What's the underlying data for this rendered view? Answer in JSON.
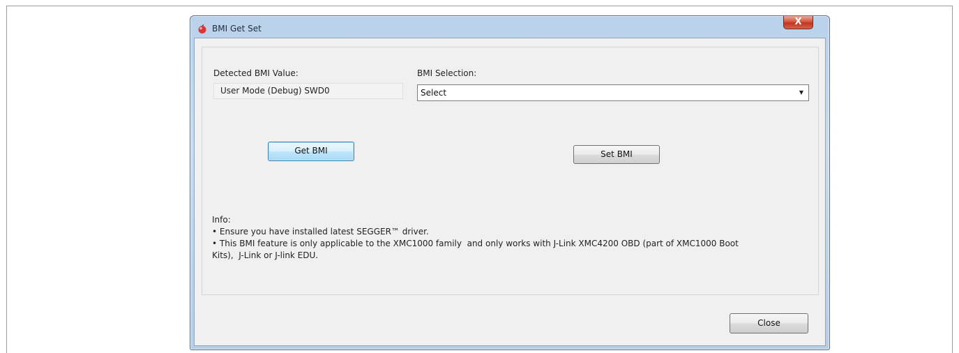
{
  "window": {
    "title": "BMI Get Set",
    "close_glyph": "X",
    "app_icon": "app-icon"
  },
  "detected": {
    "label": "Detected BMI Value:",
    "value": "User Mode (Debug) SWD0"
  },
  "selection": {
    "label": "BMI Selection:",
    "selected": "Select",
    "arrow_glyph": "▼"
  },
  "buttons": {
    "get": "Get BMI",
    "set": "Set BMI",
    "close": "Close"
  },
  "info": {
    "heading": "Info:",
    "line1": "• Ensure you have installed latest SEGGER™ driver.",
    "line2": "• This BMI feature is only applicable to the XMC1000 family  and only works with J-Link XMC4200 OBD (part of XMC1000 Boot",
    "line3": "Kits),  J-Link or J-link EDU."
  },
  "colors": {
    "title_close": "#c0341f",
    "default_button_border": "#3c7fb1"
  }
}
